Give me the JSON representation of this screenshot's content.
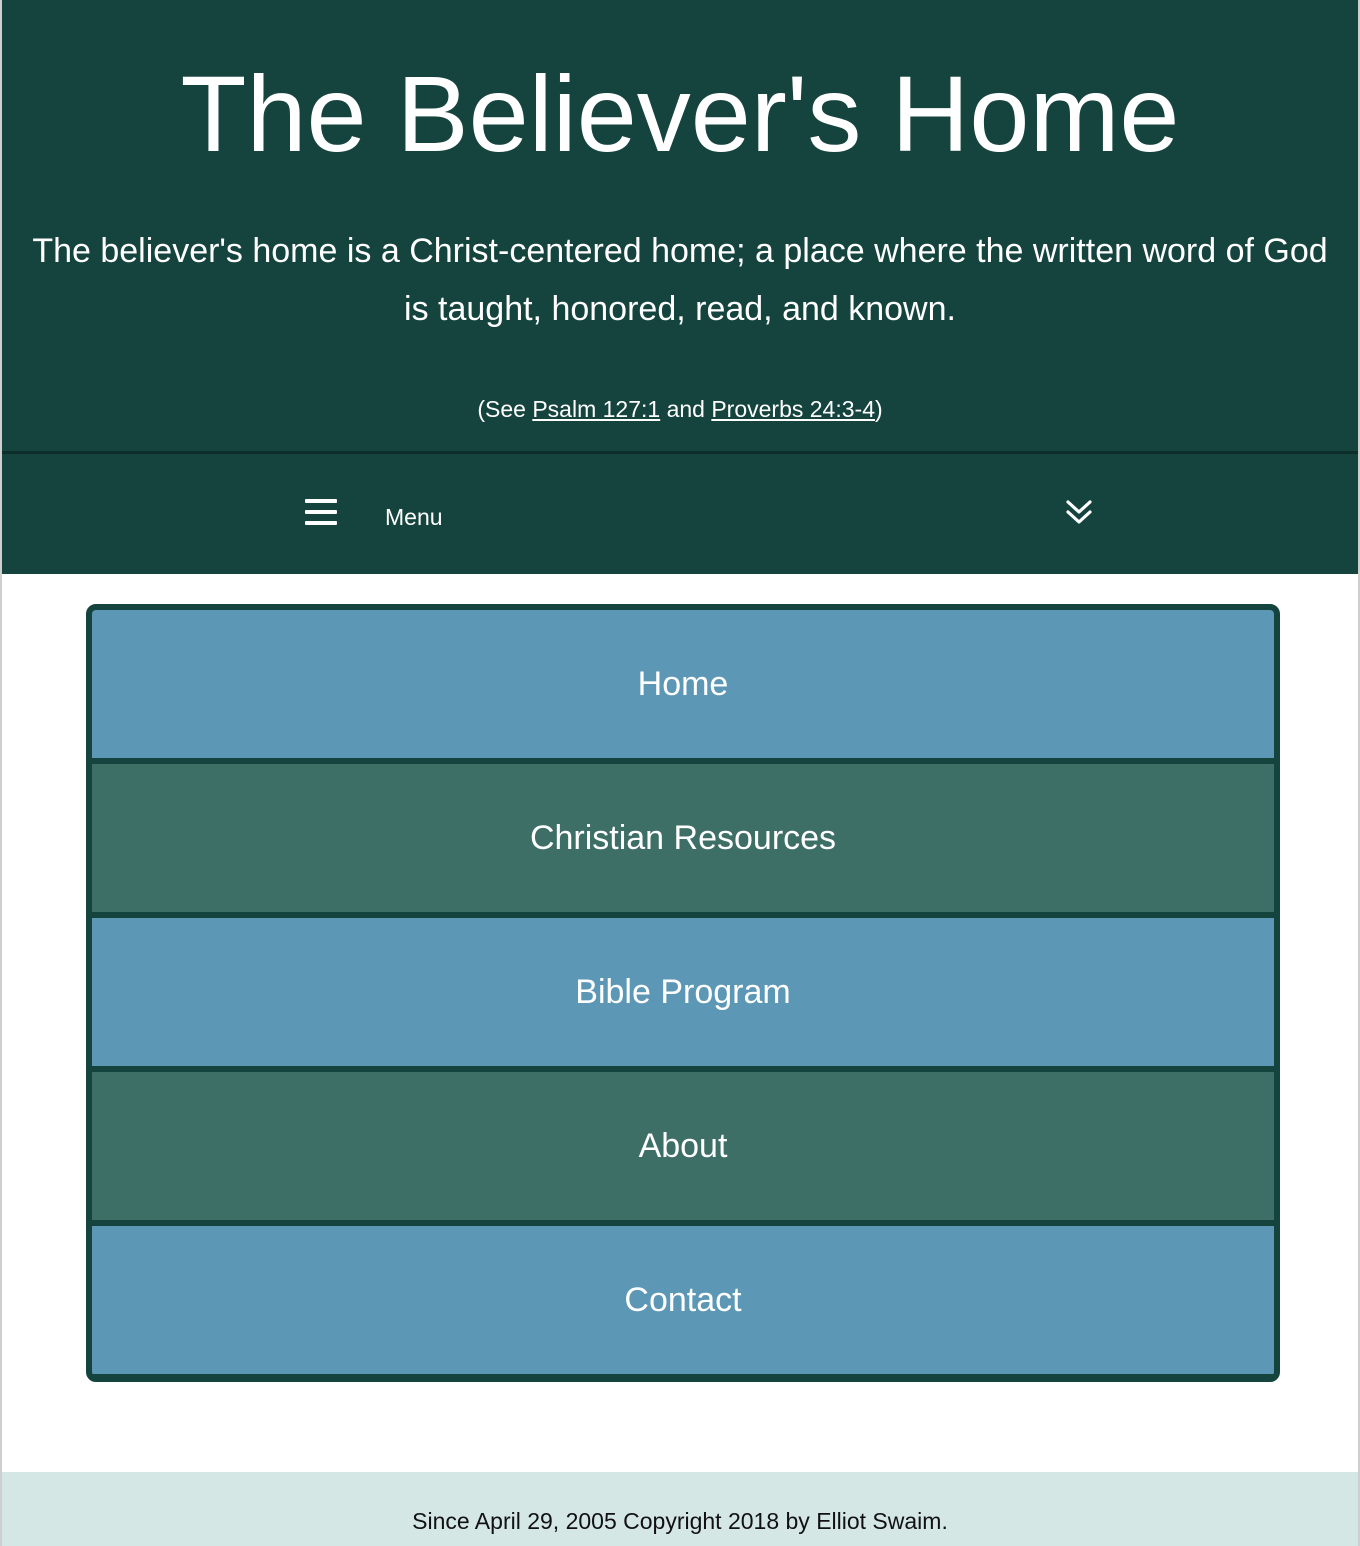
{
  "header": {
    "title": "The Believer's Home",
    "tagline": "The believer's home is a Christ-centered home; a place where the written word of God is taught, honored, read, and known.",
    "reference": {
      "prefix": "(See ",
      "link1": "Psalm 127:1",
      "middle": " and ",
      "link2": "Proverbs 24:3-4",
      "suffix": ")"
    }
  },
  "menubar": {
    "menu_label": "Menu",
    "menu_icon": "hamburger-icon",
    "toggle_icon": "double-chevron-down-icon"
  },
  "nav": {
    "items": [
      {
        "label": "Home",
        "color": "#5d97b6"
      },
      {
        "label": "Christian Resources",
        "color": "#3d6f67"
      },
      {
        "label": "Bible Program",
        "color": "#5d97b6"
      },
      {
        "label": "About",
        "color": "#3d6f67"
      },
      {
        "label": "Contact",
        "color": "#5d97b6"
      }
    ]
  },
  "footer": {
    "text": "Since April 29, 2005 Copyright 2018 by Elliot Swaim."
  },
  "colors": {
    "header_bg": "#15443e",
    "nav_blue": "#5d97b6",
    "nav_green": "#3d6f67",
    "footer_bg": "#d4e7e5"
  }
}
